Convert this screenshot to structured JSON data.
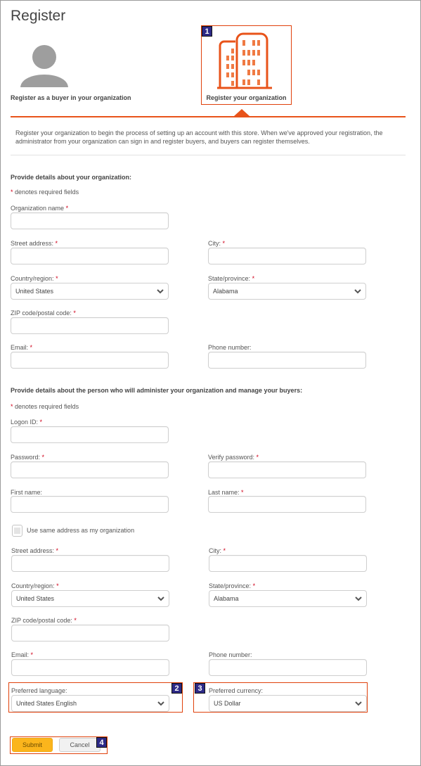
{
  "page": {
    "title": "Register"
  },
  "registration_options": [
    {
      "label": "Register as a buyer in your organization",
      "icon": "person-icon"
    },
    {
      "label": "Register your organization",
      "icon": "building-icon",
      "selected": true
    }
  ],
  "intro": "Register your organization to begin the process of setting up an account with this store. When we've approved your registration, the administrator from your organization can sign in and register buyers, and buyers can register themselves.",
  "organization_section": {
    "heading": "Provide details about your organization:",
    "required_note": "denotes required fields",
    "required_marker": "*",
    "fields": {
      "org_name": {
        "label": "Organization name",
        "value": ""
      },
      "street": {
        "label": "Street address:",
        "value": ""
      },
      "city": {
        "label": "City:",
        "value": ""
      },
      "country": {
        "label": "Country/region:",
        "value": "United States"
      },
      "state": {
        "label": "State/province:",
        "value": "Alabama"
      },
      "zip": {
        "label": "ZIP code/postal code:",
        "value": ""
      },
      "email": {
        "label": "Email:",
        "value": ""
      },
      "phone": {
        "label": "Phone number:",
        "value": ""
      }
    }
  },
  "admin_section": {
    "heading": "Provide details about the person who will administer your organization and manage your buyers:",
    "required_note": "denotes required fields",
    "required_marker": "*",
    "fields": {
      "logon_id": {
        "label": "Logon ID:",
        "value": ""
      },
      "password": {
        "label": "Password:",
        "value": ""
      },
      "verify_password": {
        "label": "Verify password:",
        "value": ""
      },
      "first_name": {
        "label": "First name:",
        "value": ""
      },
      "last_name": {
        "label": "Last name:",
        "value": ""
      },
      "same_address": {
        "label": "Use same address as my organization",
        "checked": false
      },
      "street": {
        "label": "Street address:",
        "value": ""
      },
      "city": {
        "label": "City:",
        "value": ""
      },
      "country": {
        "label": "Country/region:",
        "value": "United States"
      },
      "state": {
        "label": "State/province:",
        "value": "Alabama"
      },
      "zip": {
        "label": "ZIP code/postal code:",
        "value": ""
      },
      "email": {
        "label": "Email:",
        "value": ""
      },
      "phone": {
        "label": "Phone number:",
        "value": ""
      },
      "language": {
        "label": "Preferred language:",
        "value": "United States English"
      },
      "currency": {
        "label": "Preferred currency:",
        "value": "US Dollar"
      }
    }
  },
  "buttons": {
    "submit": "Submit",
    "cancel": "Cancel"
  },
  "callouts": [
    "1",
    "2",
    "3",
    "4"
  ],
  "colors": {
    "accent": "#e8531a",
    "callout_bg": "#2d2a87",
    "submit_bg": "#fbb51c",
    "required": "#d0021b",
    "icon_gray": "#9e9e9e"
  }
}
